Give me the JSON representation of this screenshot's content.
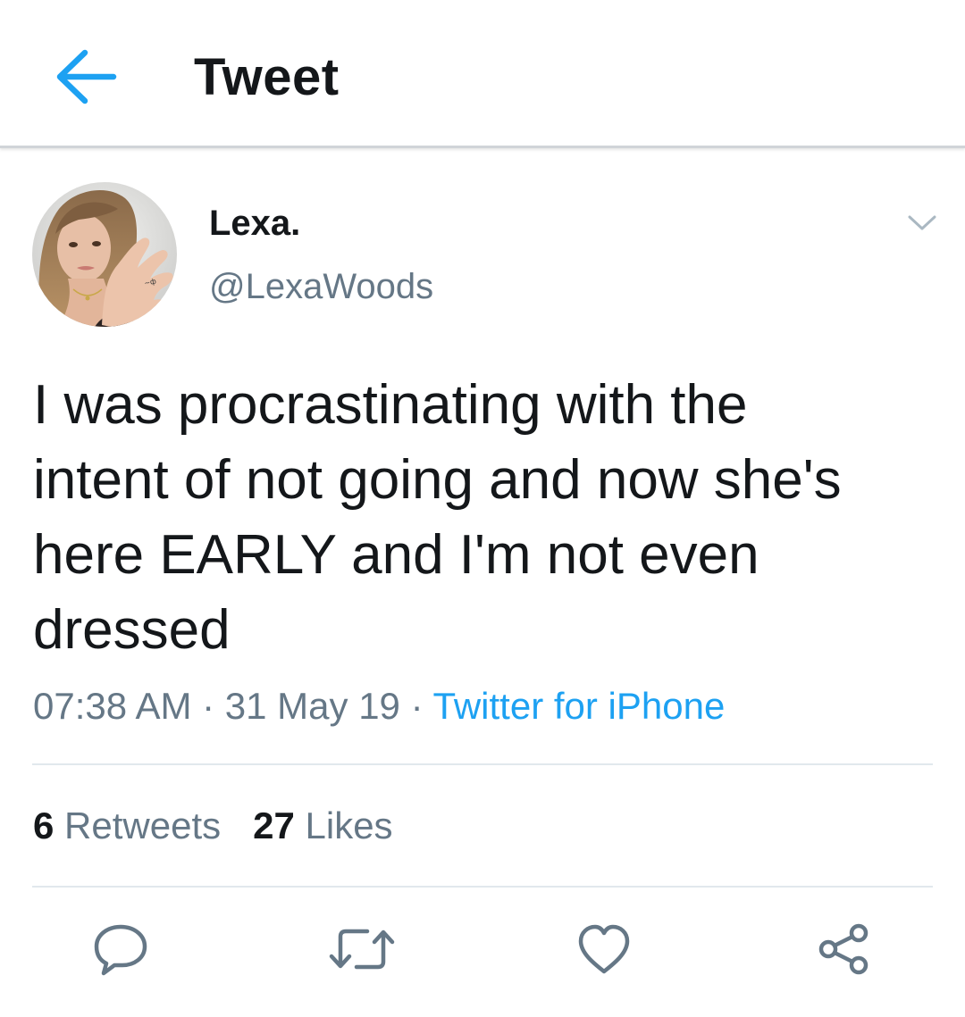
{
  "header": {
    "title": "Tweet",
    "back_icon": "arrow-left-icon",
    "accent_color": "#1da1f2"
  },
  "tweet": {
    "author": {
      "display_name": "Lexa.",
      "handle": "@LexaWoods",
      "avatar": "profile-photo"
    },
    "text": "I was procrastinating with the\nintent of not going and now she's\nhere EARLY and I'm not even\ndressed",
    "time": "07:38 AM",
    "date": "31 May 19",
    "separator": " · ",
    "source": "Twitter for iPhone",
    "menu_icon": "chevron-down-icon"
  },
  "stats": {
    "retweets_count": "6",
    "retweets_label": "Retweets",
    "likes_count": "27",
    "likes_label": "Likes"
  },
  "actions": [
    {
      "name": "reply",
      "icon": "reply-bubble-icon"
    },
    {
      "name": "retweet",
      "icon": "retweet-icon"
    },
    {
      "name": "like",
      "icon": "heart-icon"
    },
    {
      "name": "share",
      "icon": "share-icon"
    }
  ],
  "colors": {
    "text_primary": "#14171a",
    "text_secondary": "#657786",
    "link": "#1da1f2",
    "divider": "#e1e8ed"
  }
}
